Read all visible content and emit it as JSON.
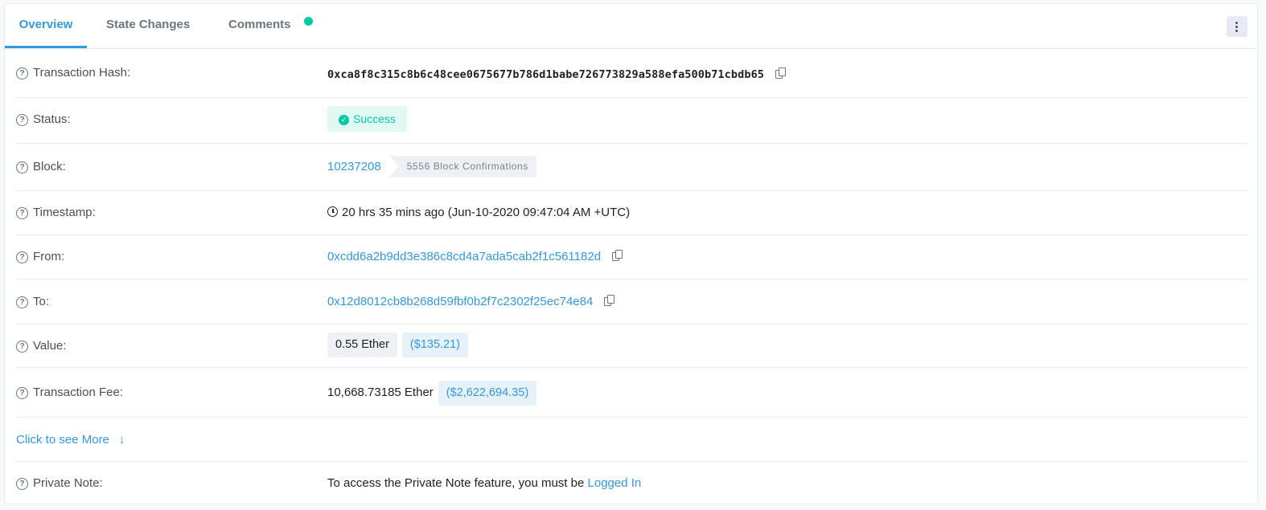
{
  "tabs": {
    "overview": "Overview",
    "state_changes": "State Changes",
    "comments": "Comments"
  },
  "rows": {
    "hash": {
      "label": "Transaction Hash:",
      "value": "0xca8f8c315c8b6c48cee0675677b786d1babe726773829a588efa500b71cbdb65"
    },
    "status": {
      "label": "Status:",
      "value": "Success"
    },
    "block": {
      "label": "Block:",
      "value": "10237208",
      "confirmations": "5556 Block Confirmations"
    },
    "timestamp": {
      "label": "Timestamp:",
      "value": "20 hrs 35 mins ago (Jun-10-2020 09:47:04 AM +UTC)"
    },
    "from": {
      "label": "From:",
      "value": "0xcdd6a2b9dd3e386c8cd4a7ada5cab2f1c561182d"
    },
    "to": {
      "label": "To:",
      "value": "0x12d8012cb8b268d59fbf0b2f7c2302f25ec74e84"
    },
    "value": {
      "label": "Value:",
      "amount": "0.55 Ether",
      "usd": "($135.21)"
    },
    "fee": {
      "label": "Transaction Fee:",
      "amount": "10,668.73185 Ether",
      "usd": "($2,622,694.35)"
    },
    "see_more": "Click to see More",
    "note": {
      "label": "Private Note:",
      "text": "To access the Private Note feature, you must be",
      "link": "Logged In"
    }
  },
  "icons": {
    "help": "question-circle-icon",
    "copy": "copy-icon",
    "check": "check-circle-icon",
    "clock": "clock-icon",
    "arrow": "arrow-down-icon",
    "more": "ellipsis-vertical-icon"
  },
  "colors": {
    "accent": "#3498db",
    "success": "#00c9a7",
    "border": "#e7eaf3"
  }
}
